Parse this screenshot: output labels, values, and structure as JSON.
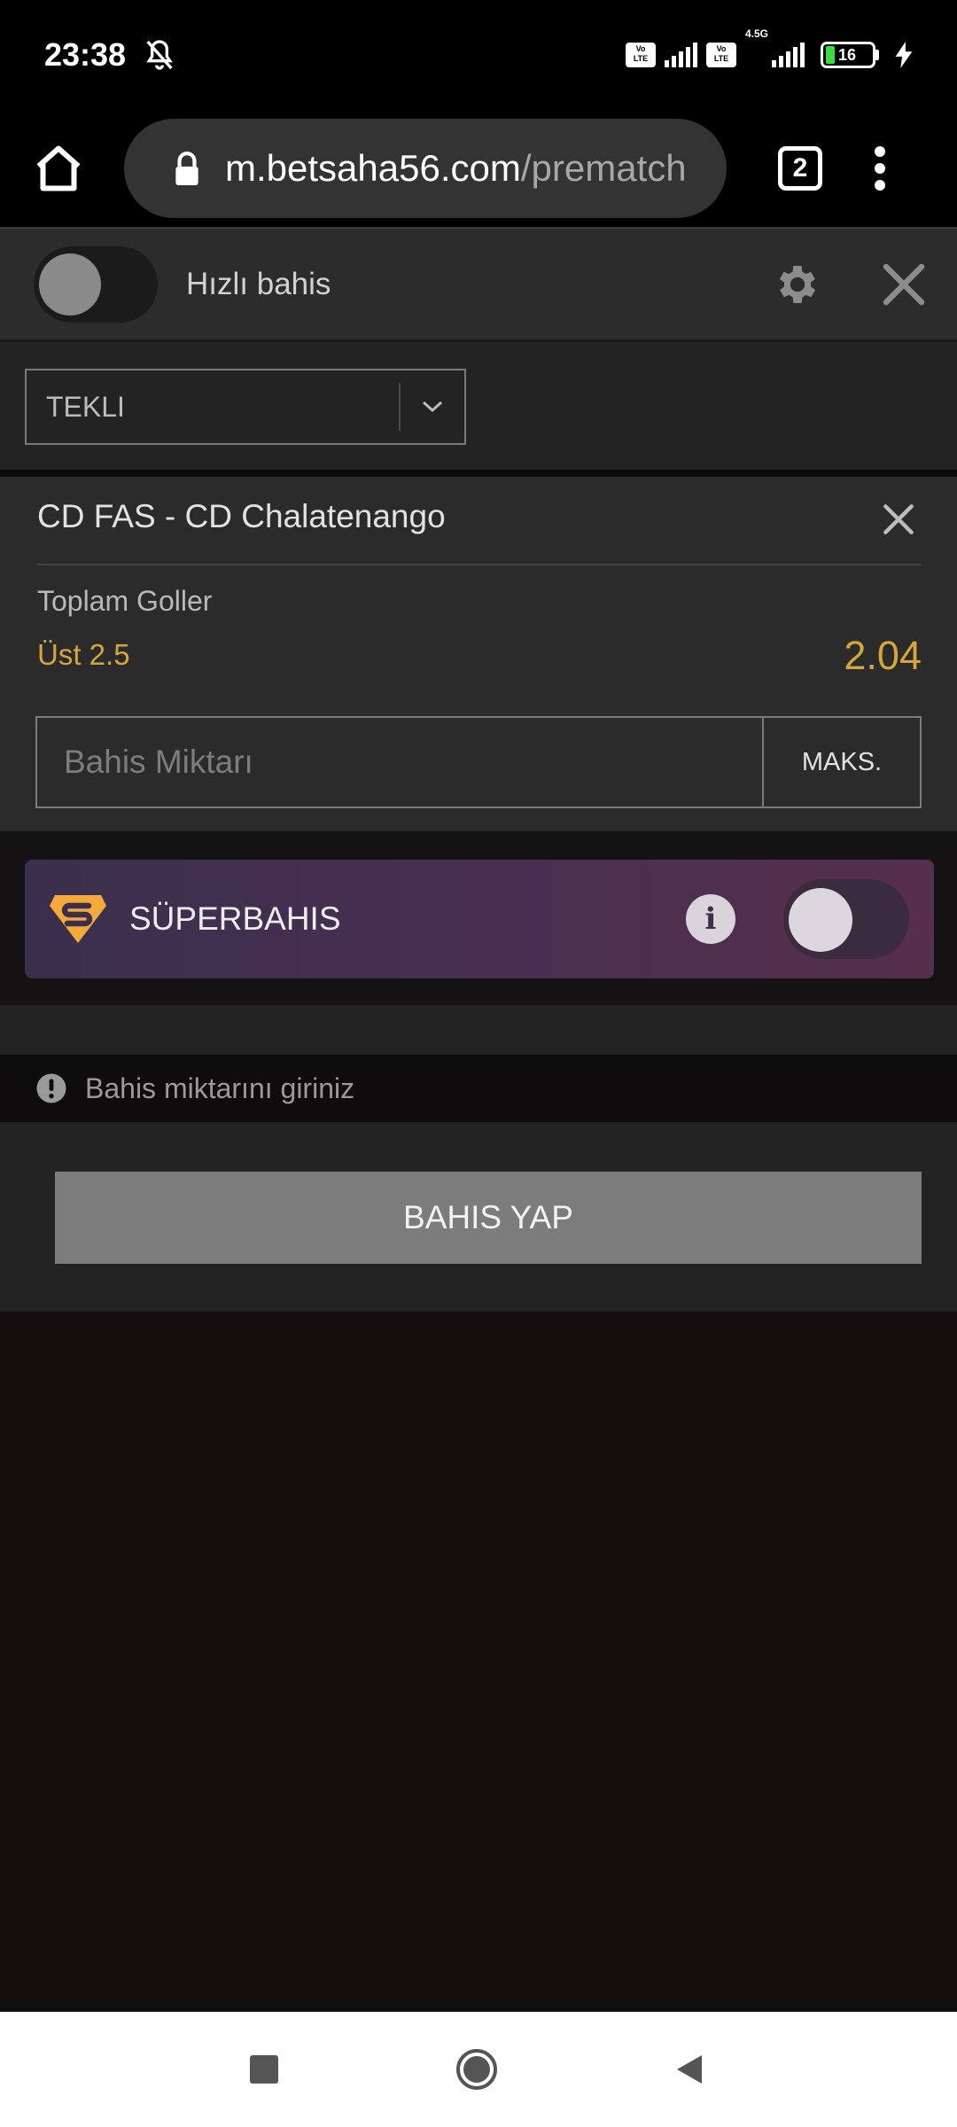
{
  "status_bar": {
    "time": "23:38",
    "net_label": "4.5G",
    "battery": "16"
  },
  "browser": {
    "url_domain": "m.betsaha56.com",
    "url_path": "/prematch",
    "tab_count": "2"
  },
  "quick_bet": {
    "label": "Hızlı bahis",
    "enabled": false
  },
  "bet_type": {
    "selected": "TEKLI"
  },
  "bet": {
    "match": "CD FAS - CD Chalatenango",
    "market": "Toplam Goller",
    "selection": "Üst 2.5",
    "odds": "2.04"
  },
  "stake": {
    "placeholder": "Bahis Miktarı",
    "value": "",
    "max_label": "MAKS."
  },
  "super_bet": {
    "label": "SÜPERBAHIS",
    "info": "i",
    "enabled": false
  },
  "warning": {
    "text": "Bahis miktarını giriniz"
  },
  "place_bet": {
    "label": "BAHIS YAP"
  },
  "colors": {
    "accent_gold": "#d4a63b",
    "background": "#110e0d",
    "panel": "#2b2b2b",
    "super_banner": "#4a2f4f"
  }
}
